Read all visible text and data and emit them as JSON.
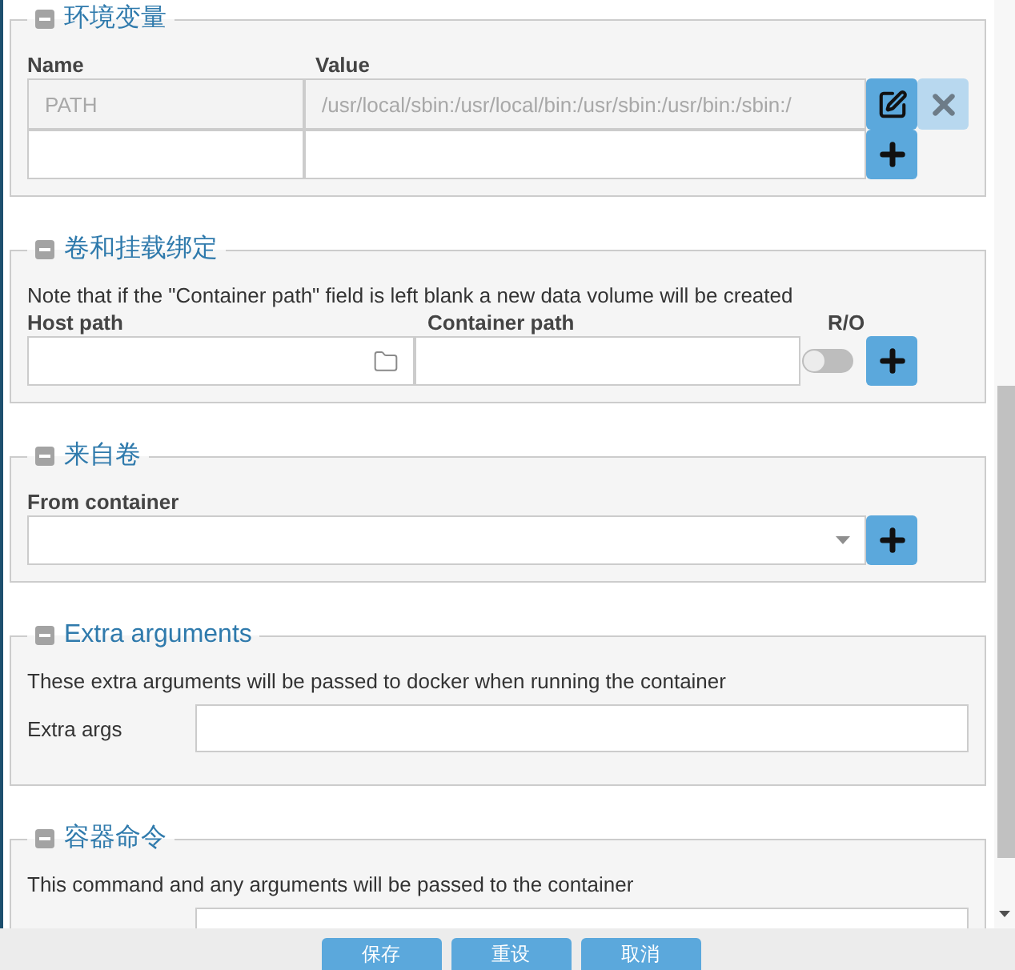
{
  "sections": [
    {
      "kind": "environment",
      "title": "环境变量",
      "expanded": true,
      "columns": [
        "Name",
        "Value"
      ],
      "rows": [
        {
          "name": "PATH",
          "value": "/usr/local/sbin:/usr/local/bin:/usr/sbin:/usr/bin:/sbin:/",
          "disabled": true
        }
      ]
    },
    {
      "kind": "volumes",
      "title": "卷和挂载绑定",
      "expanded": true,
      "note": "Note that if the \"Container path\" field is left blank a new data volume will be created",
      "columns": [
        "Host path",
        "Container path",
        "R/O"
      ],
      "read_only": false
    },
    {
      "kind": "volumes_from",
      "title": "来自卷",
      "expanded": true,
      "label": "From container"
    },
    {
      "kind": "extra_arguments",
      "title": "Extra arguments",
      "expanded": true,
      "description": "These extra arguments will be passed to docker when running the container",
      "label": "Extra args"
    },
    {
      "kind": "command",
      "title": "容器命令",
      "expanded": true,
      "description": "This command and any arguments will be passed to the container"
    }
  ],
  "buttons": [
    {
      "label": "保存"
    },
    {
      "label": "重设"
    },
    {
      "label": "取消"
    }
  ]
}
